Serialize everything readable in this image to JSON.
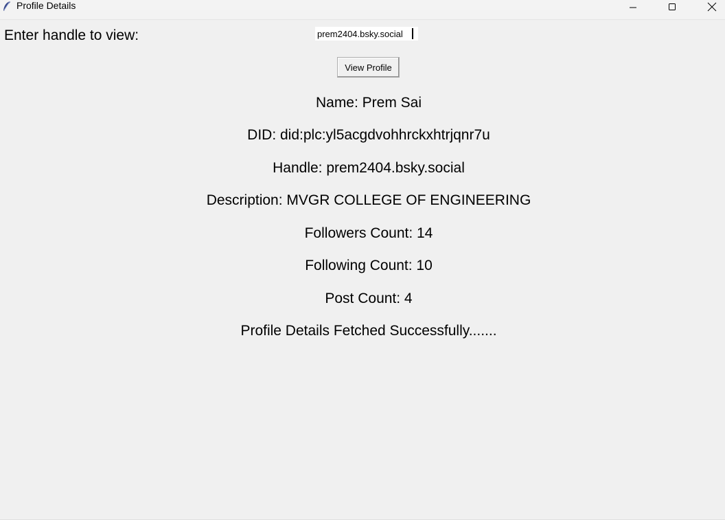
{
  "window": {
    "title": "Profile Details",
    "app_icon": "feather-icon",
    "controls": [
      "minimize-icon",
      "maximize-icon",
      "close-icon"
    ]
  },
  "form": {
    "prompt_label": "Enter handle to view:",
    "handle_value": "prem2404.bsky.social",
    "button_label": "View Profile"
  },
  "details": {
    "name": "Name: Prem Sai",
    "did": "DID: did:plc:yl5acgdvohhrckxhtrjqnr7u",
    "handle": "Handle: prem2404.bsky.social",
    "description": "Description: MVGR COLLEGE OF ENGINEERING",
    "followers": "Followers Count: 14",
    "following": "Following Count: 10",
    "posts": "Post Count: 4"
  },
  "status": {
    "message": "Profile Details Fetched Successfully......."
  }
}
